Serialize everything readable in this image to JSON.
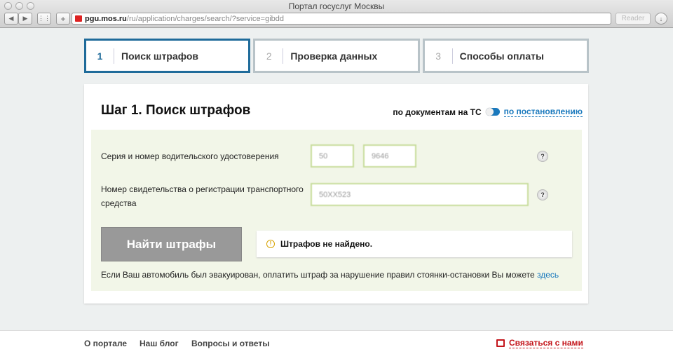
{
  "browser": {
    "title": "Портал госуслуг Москвы",
    "url_host": "pgu.mos.ru",
    "url_path": "/ru/application/charges/search/?service=gibdd",
    "reader": "Reader"
  },
  "steps": [
    {
      "num": "1",
      "label": "Поиск штрафов"
    },
    {
      "num": "2",
      "label": "Проверка данных"
    },
    {
      "num": "3",
      "label": "Способы оплаты"
    }
  ],
  "card": {
    "title": "Шаг 1. Поиск штрафов",
    "switch_left": "по документам на ТС",
    "switch_right": "по постановлению",
    "license_label": "Серия и номер водительского удостоверения",
    "license_series": "50",
    "license_number": "9646",
    "reg_label": "Номер свидетельства о регистрации транспортного средства",
    "reg_value": "50ХХ523",
    "help": "?",
    "search_button": "Найти штрафы",
    "result": "Штрафов не найдено.",
    "warn_icon": "!",
    "note": "Если Ваш автомобиль был эвакуирован, оплатить штраф за нарушение правил стоянки-остановки Вы можете ",
    "note_link": "здесь"
  },
  "footer": {
    "links": [
      "О портале",
      "Наш блог",
      "Вопросы и ответы"
    ],
    "contact": "Связаться с нами"
  }
}
